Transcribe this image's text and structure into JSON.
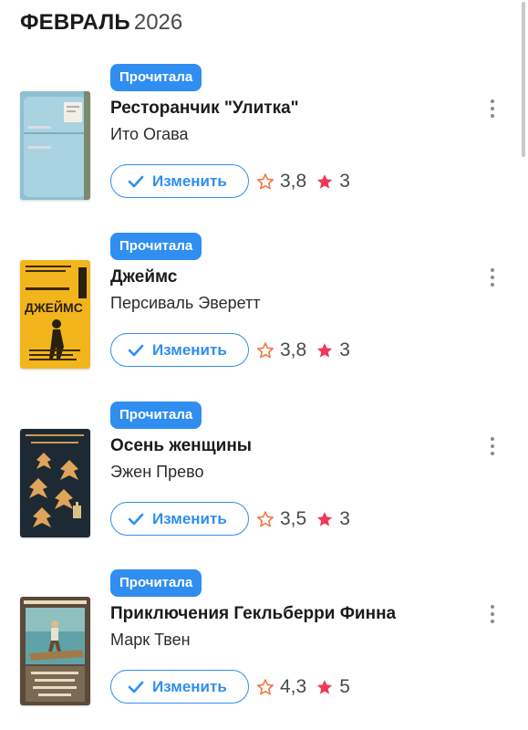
{
  "header": {
    "month": "ФЕВРАЛЬ",
    "year": "2026"
  },
  "colors": {
    "accent": "#2f8ef0",
    "star_outline": "#f07a4a",
    "star_filled": "#f0395a"
  },
  "books": [
    {
      "status": "Прочитала",
      "title": "Ресторанчик \"Улитка\"",
      "author": "Ито Огава",
      "edit_label": "Изменить",
      "avg_rating": "3,8",
      "my_rating": "3",
      "cover_icon": "blue-fridge-cover"
    },
    {
      "status": "Прочитала",
      "title": "Джеймс",
      "author": "Персиваль Эверетт",
      "edit_label": "Изменить",
      "avg_rating": "3,8",
      "my_rating": "3",
      "cover_icon": "yellow-figure-cover"
    },
    {
      "status": "Прочитала",
      "title": "Осень женщины",
      "author": "Эжен Прево",
      "edit_label": "Изменить",
      "avg_rating": "3,5",
      "my_rating": "3",
      "cover_icon": "dark-leaves-cover"
    },
    {
      "status": "Прочитала",
      "title": "Приключения Гекльберри Финна",
      "author": "Марк Твен",
      "edit_label": "Изменить",
      "avg_rating": "4,3",
      "my_rating": "5",
      "cover_icon": "raft-illustration-cover"
    }
  ]
}
